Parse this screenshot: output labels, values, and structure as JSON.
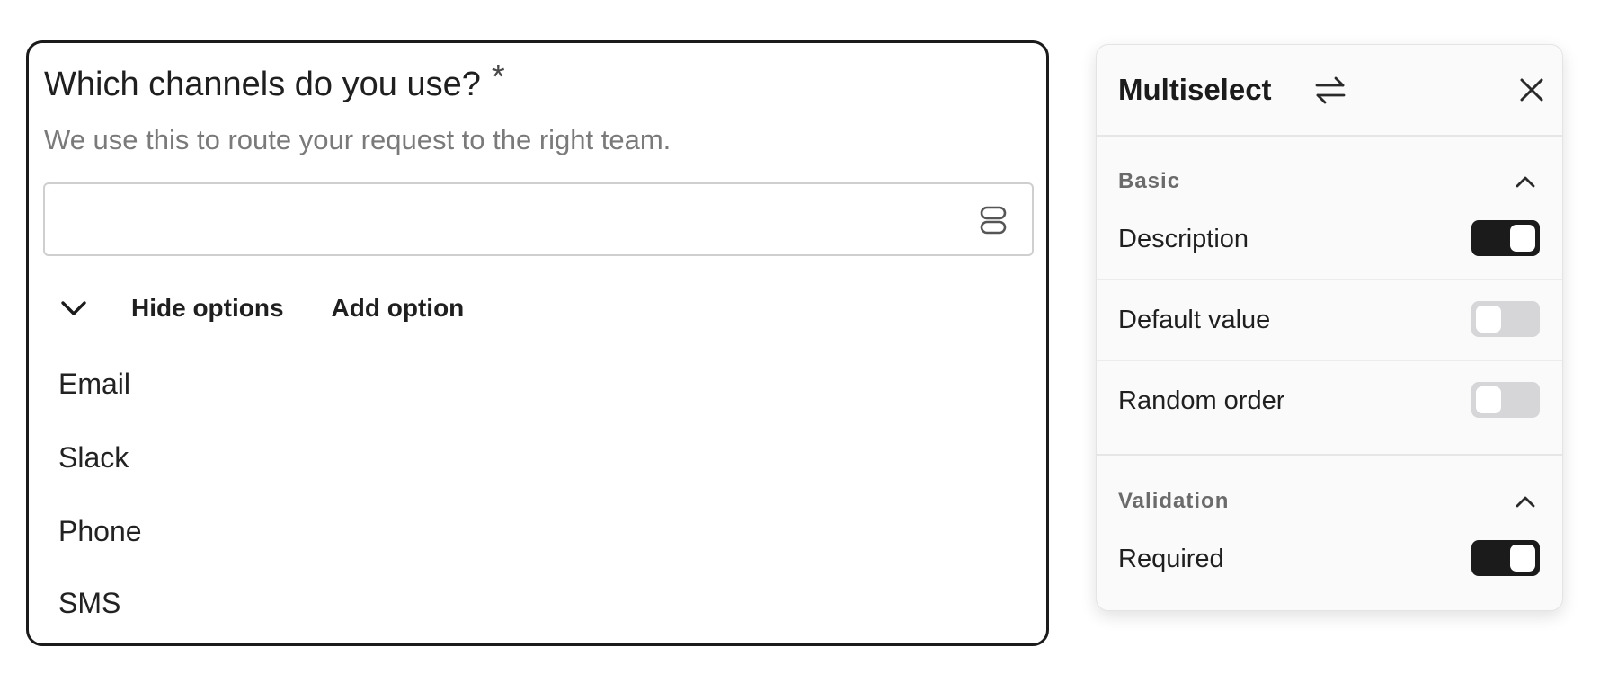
{
  "question": {
    "title": "Which channels do you use?",
    "required_marker": "*",
    "description": "We use this to route your request to the right team.",
    "answer_value": "",
    "answer_icon": "list-layout-icon",
    "toolbar": {
      "collapse_icon": "chevron-down-icon",
      "hide_options_label": "Hide options",
      "add_option_label": "Add option"
    },
    "options": [
      "Email",
      "Slack",
      "Phone",
      "SMS"
    ]
  },
  "panel": {
    "title": "Multiselect",
    "swap_icon": "swap-arrows-icon",
    "close_icon": "close-icon",
    "sections": [
      {
        "label": "Basic",
        "expanded": true,
        "settings": [
          {
            "label": "Description",
            "enabled": true
          },
          {
            "label": "Default value",
            "enabled": false
          },
          {
            "label": "Random order",
            "enabled": false
          }
        ]
      },
      {
        "label": "Validation",
        "expanded": true,
        "settings": [
          {
            "label": "Required",
            "enabled": true
          }
        ]
      }
    ]
  },
  "colors": {
    "card_border": "#1b1b1b",
    "toggle_on": "#1b1b1b",
    "toggle_off": "#d6d6d8",
    "muted_text": "#7a7a7a",
    "panel_background": "#fafafa"
  }
}
